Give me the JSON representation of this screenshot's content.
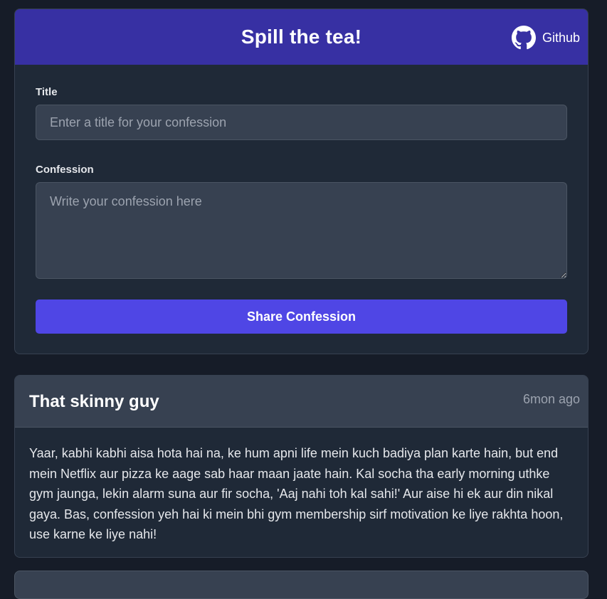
{
  "header": {
    "title": "Spill the tea!",
    "github_label": "Github"
  },
  "form": {
    "title_label": "Title",
    "title_placeholder": "Enter a title for your confession",
    "title_value": "",
    "confession_label": "Confession",
    "confession_placeholder": "Write your confession here",
    "confession_value": "",
    "submit_label": "Share Confession"
  },
  "posts": [
    {
      "title": "That skinny guy",
      "time": "6mon ago",
      "body": "Yaar, kabhi kabhi aisa hota hai na, ke hum apni life mein kuch badiya plan karte hain, but end mein Netflix aur pizza ke aage sab haar maan jaate hain. Kal socha tha early morning uthke gym jaunga, lekin alarm suna aur fir socha, 'Aaj nahi toh kal sahi!' Aur aise hi ek aur din nikal gaya. Bas, confession yeh hai ki mein bhi gym membership sirf motivation ke liye rakhta hoon, use karne ke liye nahi!"
    }
  ],
  "colors": {
    "page_bg": "#161c28",
    "card_bg": "#1f2937",
    "header_bg": "#3730a3",
    "accent": "#4f46e5",
    "post_header_bg": "#374151"
  },
  "icons": {
    "github": "github-icon"
  }
}
